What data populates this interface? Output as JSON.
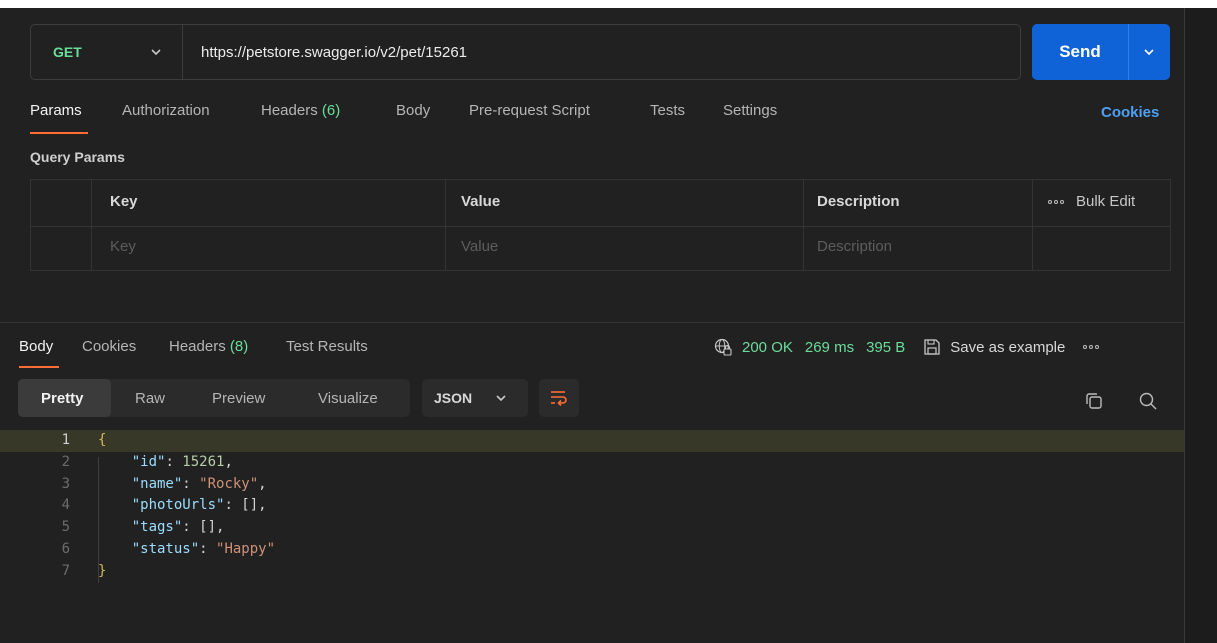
{
  "request": {
    "method": "GET",
    "url": "https://petstore.swagger.io/v2/pet/15261",
    "send_label": "Send"
  },
  "request_tabs": [
    {
      "label": "Params",
      "count": "",
      "active": true
    },
    {
      "label": "Authorization",
      "count": "",
      "active": false
    },
    {
      "label": "Headers",
      "count": "(6)",
      "active": false
    },
    {
      "label": "Body",
      "count": "",
      "active": false
    },
    {
      "label": "Pre-request Script",
      "count": "",
      "active": false
    },
    {
      "label": "Tests",
      "count": "",
      "active": false
    },
    {
      "label": "Settings",
      "count": "",
      "active": false
    }
  ],
  "cookies_link": "Cookies",
  "query_params": {
    "title": "Query Params",
    "headers": [
      "Key",
      "Value",
      "Description"
    ],
    "bulk_edit": "Bulk Edit",
    "placeholders": [
      "Key",
      "Value",
      "Description"
    ]
  },
  "response_tabs": [
    {
      "label": "Body",
      "count": "",
      "active": true
    },
    {
      "label": "Cookies",
      "count": "",
      "active": false
    },
    {
      "label": "Headers",
      "count": "(8)",
      "active": false
    },
    {
      "label": "Test Results",
      "count": "",
      "active": false
    }
  ],
  "response_meta": {
    "status": "200 OK",
    "time": "269 ms",
    "size": "395 B",
    "save_example": "Save as example"
  },
  "view_modes": [
    "Pretty",
    "Raw",
    "Preview",
    "Visualize"
  ],
  "format": "JSON",
  "code": {
    "line_numbers": [
      "1",
      "2",
      "3",
      "4",
      "5",
      "6",
      "7"
    ],
    "open_brace": "{",
    "close_brace": "}",
    "id_key": "\"id\"",
    "id_val": "15261",
    "name_key": "\"name\"",
    "name_val": "\"Rocky\"",
    "photo_key": "\"photoUrls\"",
    "photo_val": "[]",
    "tags_key": "\"tags\"",
    "tags_val": "[]",
    "status_key": "\"status\"",
    "status_val": "\"Happy\""
  },
  "colors": {
    "method_green": "#6bdd9a",
    "send_blue": "#0f63d6",
    "tab_accent": "#ff6c37",
    "link_blue": "#4ea0f2"
  }
}
